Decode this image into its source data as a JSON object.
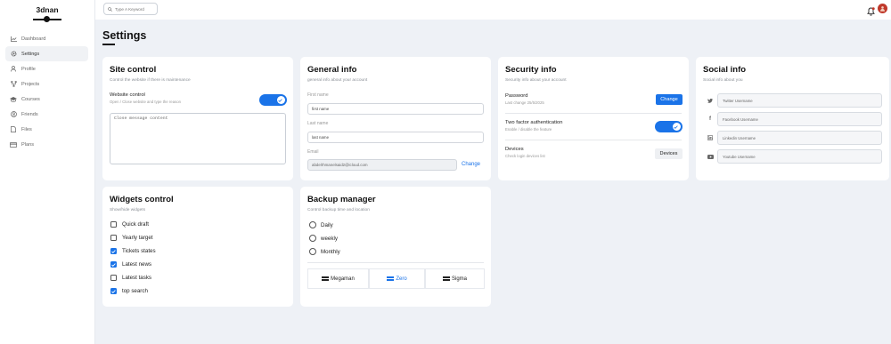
{
  "brand": {
    "name": "3dnan"
  },
  "sidebar": {
    "items": [
      {
        "label": "Dashboard",
        "icon": "chart-icon"
      },
      {
        "label": "Settings",
        "icon": "gear-icon"
      },
      {
        "label": "Profile",
        "icon": "user-icon"
      },
      {
        "label": "Projects",
        "icon": "diagram-icon"
      },
      {
        "label": "Courses",
        "icon": "graduation-cap-icon"
      },
      {
        "label": "Friends",
        "icon": "users-icon"
      },
      {
        "label": "Files",
        "icon": "file-icon"
      },
      {
        "label": "Plans",
        "icon": "credit-card-icon"
      }
    ],
    "active_index": 1
  },
  "search": {
    "placeholder": "Type A Keyword"
  },
  "page": {
    "title": "Settings"
  },
  "site_control": {
    "title": "Site control",
    "desc": "Control the website if there is maintenance",
    "website_control_label": "Website control",
    "website_control_sub": "Open / Close website and type the reason",
    "toggle_on": true,
    "message_placeholder": "Close message content"
  },
  "general_info": {
    "title": "General info",
    "desc": "general info about your account",
    "first_name_label": "First name",
    "first_name_placeholder": "first name",
    "last_name_label": "Last name",
    "last_name_placeholder": "last name",
    "email_label": "Email",
    "email_value": "abdelrhmanelsaid2@icloud.com",
    "change_label": "Change"
  },
  "security_info": {
    "title": "Security info",
    "desc": "Security info about your account",
    "password_label": "Password",
    "password_sub": "Last change 25/5/2025",
    "password_button": "Change",
    "two_factor_label": "Two factor authentication",
    "two_factor_sub": "Enable / disable the feature",
    "two_factor_on": true,
    "devices_label": "Devices",
    "devices_sub": "Check login devices list",
    "devices_button": "Devices"
  },
  "social_info": {
    "title": "Social info",
    "desc": "Social info about you",
    "fields": [
      {
        "icon": "twitter-icon",
        "placeholder": "Twitter Username"
      },
      {
        "icon": "facebook-icon",
        "placeholder": "Facebook Username"
      },
      {
        "icon": "linkedin-icon",
        "placeholder": "Linkedin Username"
      },
      {
        "icon": "youtube-icon",
        "placeholder": "Youtube Username"
      }
    ]
  },
  "widgets_control": {
    "title": "Widgets control",
    "desc": "Show/hide widgets",
    "items": [
      {
        "label": "Quick draft",
        "checked": false
      },
      {
        "label": "Yearly target",
        "checked": false
      },
      {
        "label": "Tickets states",
        "checked": true
      },
      {
        "label": "Latest news",
        "checked": true
      },
      {
        "label": "Latest tasks",
        "checked": false
      },
      {
        "label": "top search",
        "checked": true
      }
    ]
  },
  "backup_manager": {
    "title": "Backup manager",
    "desc": "Control backup time and location",
    "options": [
      "Daily",
      "weekly",
      "Monthly"
    ],
    "servers": [
      {
        "label": "Megaman",
        "selected": false
      },
      {
        "label": "Zero",
        "selected": true
      },
      {
        "label": "Sigma",
        "selected": false
      }
    ]
  },
  "colors": {
    "accent": "#1a73e8",
    "avatar": "#c0392b",
    "bell": "#c0392b"
  }
}
